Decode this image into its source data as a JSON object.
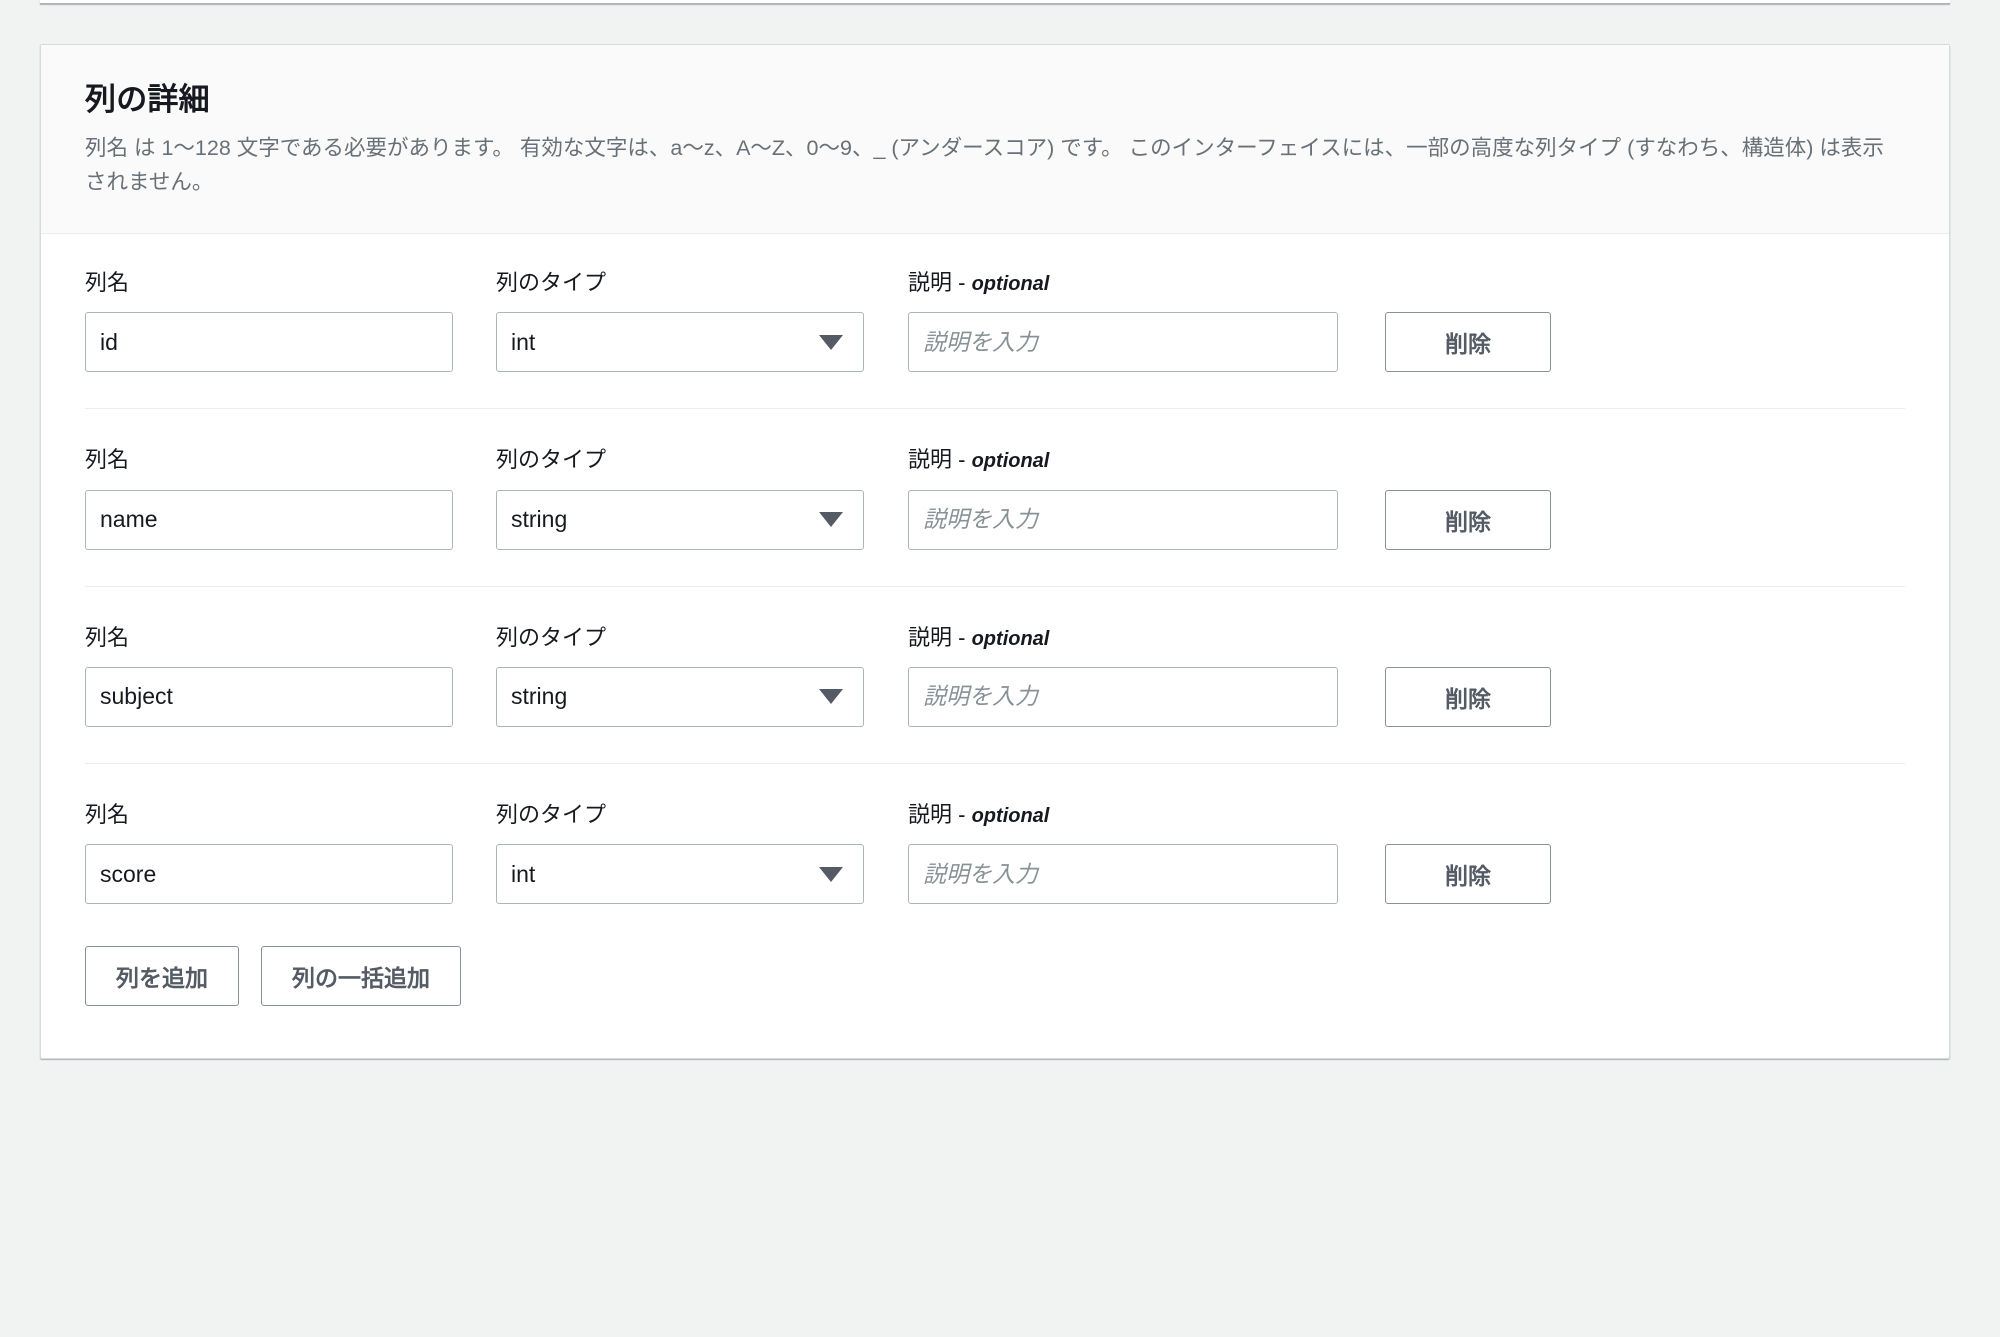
{
  "card": {
    "title": "列の詳細",
    "description": "列名 は 1〜128 文字である必要があります。 有効な文字は、a〜z、A〜Z、0〜9、_ (アンダースコア) です。 このインターフェイスには、一部の高度な列タイプ (すなわち、構造体) は表示されません。"
  },
  "labels": {
    "column_name": "列名",
    "column_type": "列のタイプ",
    "description": "説明",
    "description_optional_dash": "-",
    "description_optional": "optional"
  },
  "placeholders": {
    "description": "説明を入力"
  },
  "buttons": {
    "delete": "削除",
    "add_column": "列を追加",
    "bulk_add_columns": "列の一括追加"
  },
  "colors": {
    "page_background": "#f1f3f3",
    "card_background": "#ffffff",
    "header_background": "#fafafa",
    "border": "#d5dbdb",
    "input_border": "#aab7b8",
    "text": "#16191f",
    "muted_text": "#687078",
    "placeholder_text": "#879196",
    "button_text": "#545b64"
  },
  "rows": [
    {
      "name": "id",
      "type": "int",
      "description": ""
    },
    {
      "name": "name",
      "type": "string",
      "description": ""
    },
    {
      "name": "subject",
      "type": "string",
      "description": ""
    },
    {
      "name": "score",
      "type": "int",
      "description": ""
    }
  ]
}
